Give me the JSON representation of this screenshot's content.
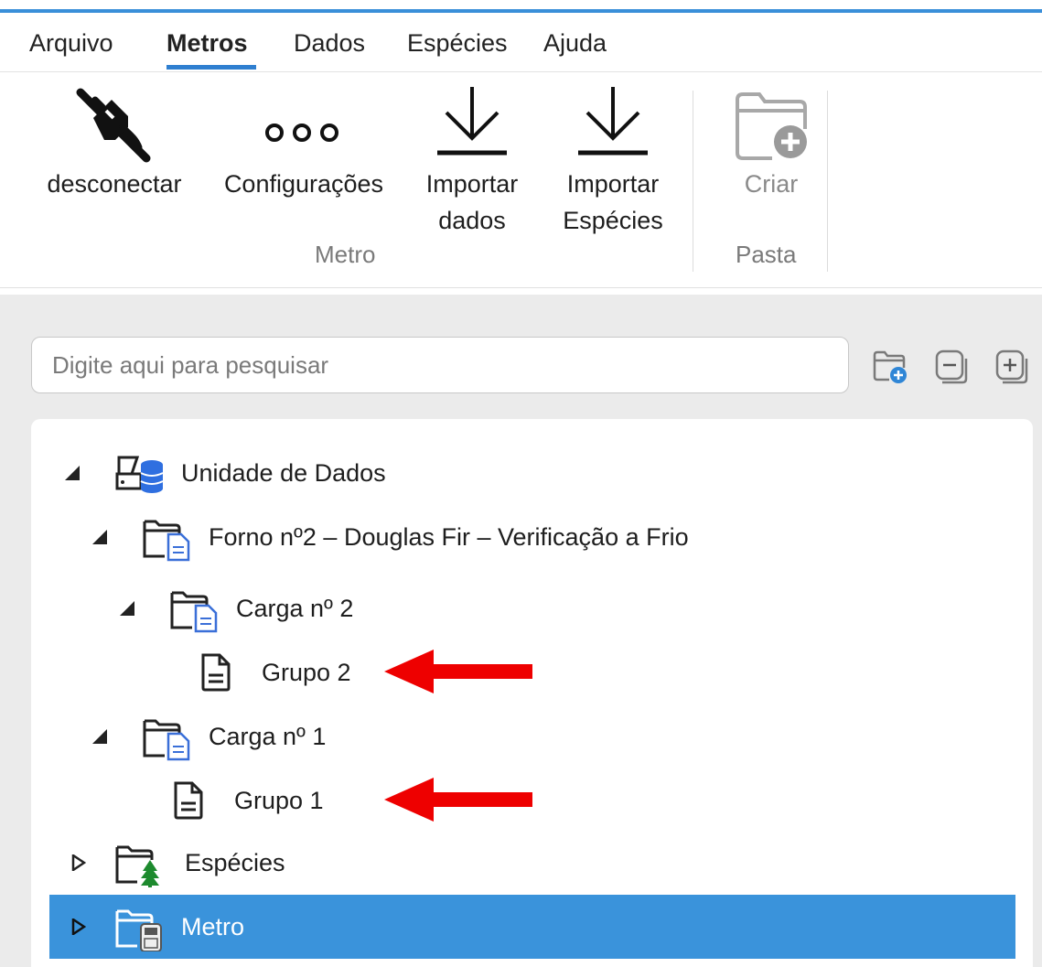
{
  "menubar": {
    "items": [
      "Arquivo",
      "Metros",
      "Dados",
      "Espécies",
      "Ajuda"
    ],
    "active": "Metros"
  },
  "ribbon": {
    "disconnect": "desconectar",
    "settings": "Configurações",
    "import_data_1": "Importar",
    "import_data_2": "dados",
    "import_species_1": "Importar",
    "import_species_2": "Espécies",
    "create": "Criar",
    "group_meter": "Metro",
    "group_folder": "Pasta"
  },
  "search": {
    "placeholder": "Digite aqui para pesquisar"
  },
  "tree": {
    "root": "Unidade de Dados",
    "kiln": "Forno nº2 – Douglas Fir – Verificação a Frio",
    "load2": "Carga nº 2",
    "group2": "Grupo 2",
    "load1": "Carga nº 1",
    "group1": "Grupo 1",
    "species": "Espécies",
    "meter": "Metro"
  },
  "colors": {
    "accent": "#3a93db",
    "arrow": "#ee0000",
    "doc_blue": "#3a6fd8",
    "tree_green": "#1d8a2e"
  }
}
